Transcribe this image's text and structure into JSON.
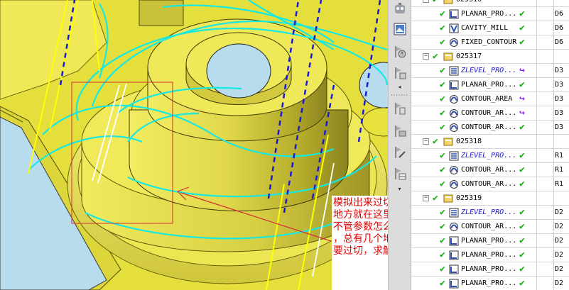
{
  "annotation": {
    "lines": [
      "模拟出来过切的",
      "地方就在这里，",
      "不管参数怎么调",
      "，总有几个地方",
      "要过切，求解决"
    ],
    "color": "#e00000"
  },
  "viewport": {
    "background": "#e7e23e",
    "toolpath_color": "#18e8e0",
    "hole_color": "#b7dcee",
    "highlight_box_color": "#d03030"
  },
  "toolbar": {
    "icons": [
      "robot-icon",
      "image-icon",
      "flag-clock-icon",
      "flag-list-icon",
      "scroll-left-icon",
      "dots-separator-icon",
      "flag-doc-icon",
      "flag-stack-icon",
      "flag-edit-icon",
      "flag-table-icon",
      "scroll-down-icon"
    ]
  },
  "navigator": {
    "rows": [
      {
        "type": "program",
        "name": "025316",
        "expander": "−"
      },
      {
        "type": "op",
        "icon": "planar",
        "name": "PLANAR_PRO...",
        "status": "ok",
        "tool": "D6",
        "name_style": "normal"
      },
      {
        "type": "op",
        "icon": "cavity",
        "name": "CAVITY_MILL",
        "status": "ok",
        "tool": "D6",
        "name_style": "normal"
      },
      {
        "type": "op",
        "icon": "contour",
        "name": "FIXED_CONTOUR",
        "status": "ok",
        "tool": "D6",
        "name_style": "normal"
      },
      {
        "type": "program",
        "name": "025317",
        "expander": "−"
      },
      {
        "type": "op",
        "icon": "zlevel",
        "name": "ZLEVEL_PRO...",
        "status": "repost",
        "tool": "D3",
        "name_style": "blue"
      },
      {
        "type": "op",
        "icon": "planar",
        "name": "PLANAR_PRO...",
        "status": "ok",
        "tool": "D3",
        "name_style": "normal"
      },
      {
        "type": "op",
        "icon": "contour",
        "name": "CONTOUR_AREA",
        "status": "repost",
        "tool": "D3",
        "name_style": "normal"
      },
      {
        "type": "op",
        "icon": "contour",
        "name": "CONTOUR_AR...",
        "status": "repost",
        "tool": "D3",
        "name_style": "normal"
      },
      {
        "type": "op",
        "icon": "contour",
        "name": "CONTOUR_AR...",
        "status": "ok",
        "tool": "D3",
        "name_style": "normal"
      },
      {
        "type": "program",
        "name": "025318",
        "expander": "−"
      },
      {
        "type": "op",
        "icon": "zlevel",
        "name": "ZLEVEL_PRO...",
        "status": "ok",
        "tool": "R1",
        "name_style": "blue"
      },
      {
        "type": "op",
        "icon": "contour",
        "name": "CONTOUR_AR...",
        "status": "ok",
        "tool": "R1",
        "name_style": "normal"
      },
      {
        "type": "op",
        "icon": "contour",
        "name": "CONTOUR_AR...",
        "status": "ok",
        "tool": "R1",
        "name_style": "normal"
      },
      {
        "type": "program",
        "name": "025319",
        "expander": "−"
      },
      {
        "type": "op",
        "icon": "zlevel",
        "name": "ZLEVEL_PRO...",
        "status": "ok",
        "tool": "D2",
        "name_style": "blue"
      },
      {
        "type": "op",
        "icon": "contour",
        "name": "CONTOUR_AR...",
        "status": "ok",
        "tool": "D2",
        "name_style": "normal"
      },
      {
        "type": "op",
        "icon": "planar",
        "name": "PLANAR_PRO...",
        "status": "ok",
        "tool": "D2",
        "name_style": "normal"
      },
      {
        "type": "op",
        "icon": "planar",
        "name": "PLANAR_PRO...",
        "status": "ok",
        "tool": "D2",
        "name_style": "normal"
      },
      {
        "type": "op",
        "icon": "planar",
        "name": "PLANAR_PRO...",
        "status": "ok",
        "tool": "D2",
        "name_style": "normal"
      },
      {
        "type": "op",
        "icon": "planar",
        "name": "PLANAR_PRO...",
        "status": "ok",
        "tool": "D2",
        "name_style": "normal"
      }
    ],
    "status_glyphs": {
      "ok": "✔",
      "repost": "↪"
    },
    "check_glyph": "✔"
  }
}
